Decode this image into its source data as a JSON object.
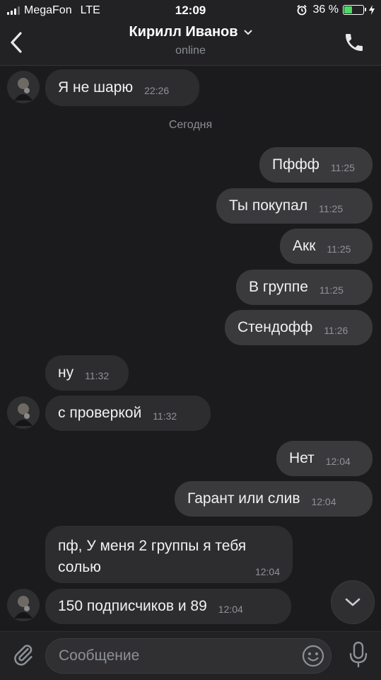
{
  "status_bar": {
    "carrier": "MegaFon",
    "network": "LTE",
    "time": "12:09",
    "battery": "36 %"
  },
  "header": {
    "contact_name": "Кирилл Иванов",
    "status": "online"
  },
  "date_separator": "Сегодня",
  "messages": [
    {
      "dir": "in",
      "text": "Я не шарю",
      "time": "22:26"
    },
    {
      "dir": "out",
      "text": "Пффф",
      "time": "11:25"
    },
    {
      "dir": "out",
      "text": "Ты покупал",
      "time": "11:25"
    },
    {
      "dir": "out",
      "text": "Акк",
      "time": "11:25"
    },
    {
      "dir": "out",
      "text": "В группе",
      "time": "11:25"
    },
    {
      "dir": "out",
      "text": "Стендофф",
      "time": "11:26"
    },
    {
      "dir": "in",
      "text": "ну",
      "time": "11:32"
    },
    {
      "dir": "in",
      "text": "с проверкой",
      "time": "11:32"
    },
    {
      "dir": "out",
      "text": "Нет",
      "time": "12:04"
    },
    {
      "dir": "out",
      "text": "Гарант или слив",
      "time": "12:04"
    },
    {
      "dir": "in",
      "text": "пф, У меня 2 группы я тебя солью",
      "time": "12:04"
    },
    {
      "dir": "in",
      "text": "150 подписчиков и 89",
      "time": "12:04"
    }
  ],
  "composer": {
    "placeholder": "Сообщение"
  },
  "colors": {
    "background": "#1b1b1d",
    "bubble_out": "#3a3a3d",
    "bubble_in": "#2d2d30",
    "battery_fill": "#4cd964"
  }
}
